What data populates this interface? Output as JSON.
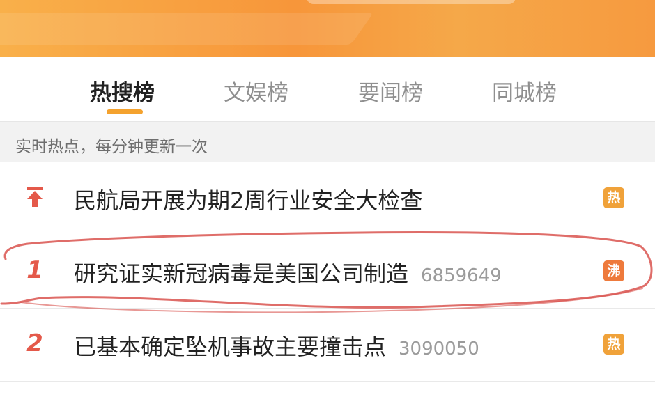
{
  "tabs": [
    {
      "label": "热搜榜",
      "active": true
    },
    {
      "label": "文娱榜",
      "active": false
    },
    {
      "label": "要闻榜",
      "active": false
    },
    {
      "label": "同城榜",
      "active": false
    }
  ],
  "subtitle": "实时热点，每分钟更新一次",
  "colors": {
    "accent": "#f4a22e",
    "rank": "#e4594a",
    "badge_hot": "#f0a23a",
    "badge_boil": "#ee7a3c",
    "annotation": "#d9534f"
  },
  "items": [
    {
      "rank": "",
      "rank_icon": "pin-top-icon",
      "title": "民航局开展为期2周行业安全大检查",
      "count": "",
      "badge": "热",
      "badge_type": "hot"
    },
    {
      "rank": "1",
      "title": "研究证实新冠病毒是美国公司制造",
      "count": "6859649",
      "badge": "沸",
      "badge_type": "boil"
    },
    {
      "rank": "2",
      "title": "已基本确定坠机事故主要撞击点",
      "count": "3090050",
      "badge": "热",
      "badge_type": "hot"
    }
  ]
}
